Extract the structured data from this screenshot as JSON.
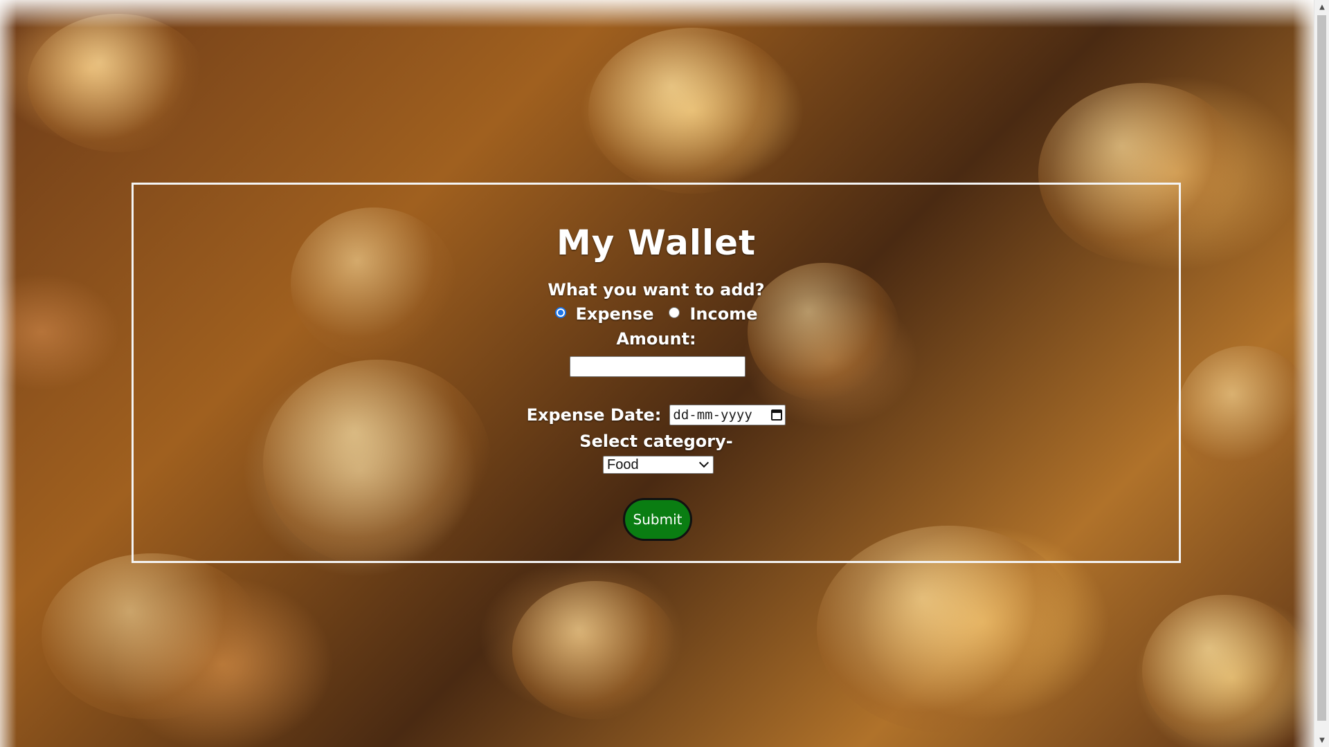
{
  "form": {
    "title": "My Wallet",
    "question": "What you want to add?",
    "type_options": [
      {
        "label": "Expense",
        "checked": true
      },
      {
        "label": "Income",
        "checked": false
      }
    ],
    "amount_label": "Amount:",
    "amount_value": "",
    "date_label": "Expense Date:",
    "date_placeholder": "dd-mm-yyyy",
    "category_label": "Select category-",
    "category_selected": "Food",
    "submit_label": "Submit"
  },
  "colors": {
    "submit_bg": "#0a7d12",
    "radio_accent": "#1a73e8",
    "panel_border": "#f4f4f4"
  },
  "icons": {
    "date_picker": "calendar-icon",
    "select": "chevron-down-icon",
    "scroll_up": "scroll-up-arrow-icon",
    "scroll_down": "scroll-down-arrow-icon"
  }
}
